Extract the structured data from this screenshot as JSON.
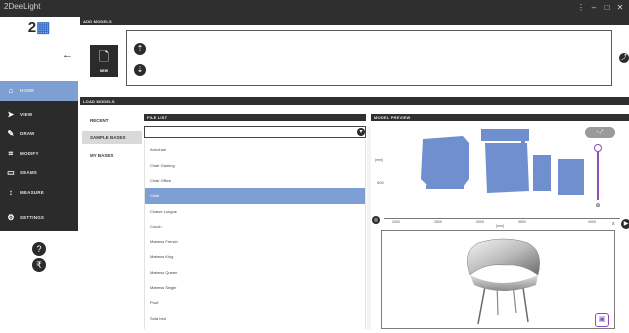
{
  "window": {
    "title": "2DeeLight",
    "controls": [
      "⋮",
      "–",
      "□",
      "✕"
    ]
  },
  "logo": {
    "text_a": "2",
    "text_b": "▦"
  },
  "nav": {
    "back_label": "←",
    "items": [
      {
        "label": "HOME",
        "icon": "home-icon",
        "glyph": "⌂"
      },
      {
        "label": "VIEW",
        "icon": "cursor-icon",
        "glyph": "➤"
      },
      {
        "label": "DRAW",
        "icon": "pencil-icon",
        "glyph": "✎"
      },
      {
        "label": "MODIFY",
        "icon": "transform-icon",
        "glyph": "⌗"
      },
      {
        "label": "SEAMS",
        "icon": "seams-icon",
        "glyph": "▭"
      },
      {
        "label": "MEASURE",
        "icon": "measure-icon",
        "glyph": "↕"
      },
      {
        "label": "SETTINGS",
        "icon": "settings-icon",
        "glyph": "⚙"
      }
    ],
    "help_glyph": "?",
    "currency_glyph": "₹"
  },
  "add_models": {
    "title": "ADD MODELS",
    "new_label": "NEW",
    "upload_glyph": "⇡",
    "download_glyph": "⇣",
    "side_glyph": "⤴"
  },
  "load_models": {
    "title": "LOAD MODELS",
    "tabs": [
      "RECENT",
      "SAMPLE BASES",
      "MY BASES"
    ],
    "active_tab": "SAMPLE BASES"
  },
  "file_list": {
    "title": "FILE LIST",
    "filter_value": "",
    "filter_glyph": "▾",
    "items": [
      "Armchair",
      "Chair Gaming",
      "Chair Office",
      "Chair",
      "Chaise Longue",
      "Couch",
      "Matress French",
      "Matress King",
      "Matress Queen",
      "Matress Single",
      "Pouf",
      "Sofa bed"
    ],
    "selected": "Chair"
  },
  "model_preview": {
    "title": "MODEL PREVIEW",
    "x_ticks": [
      "2000",
      "2500",
      "3000",
      "3500",
      "4000"
    ],
    "x_axis_tag": "[mm]",
    "y_axis_tag": "[mm]",
    "y_tick": "500",
    "x_end_label": "x",
    "tools_glyphs": "‹ ⤢",
    "slider_bottom_glyph": "⊕",
    "uv_color": "#6f8fcf",
    "accent_color": "#8a4fb8",
    "cube_glyph": "▣"
  }
}
